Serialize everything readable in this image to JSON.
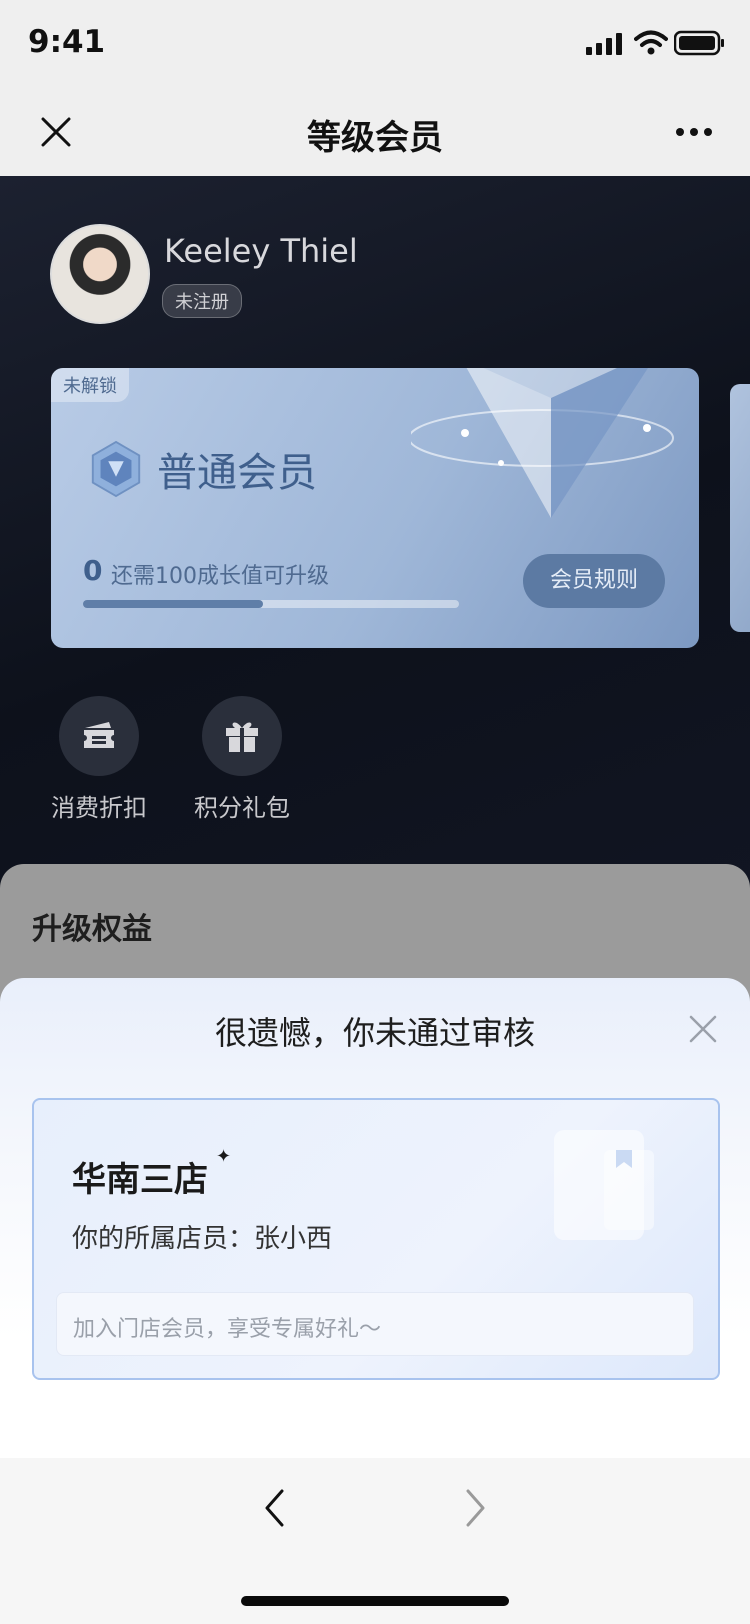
{
  "status": {
    "time": "9:41"
  },
  "nav": {
    "title": "等级会员"
  },
  "user": {
    "name": "Keeley Thiel",
    "badge": "未注册"
  },
  "member_card": {
    "lock_tag": "未解锁",
    "level_name": "普通会员",
    "progress_value": "0",
    "progress_hint": "还需100成长值可升级",
    "progress_fraction": 0.48,
    "rule_button": "会员规则"
  },
  "quick_entries": [
    {
      "label": "消费折扣",
      "icon": "ticket-icon"
    },
    {
      "label": "积分礼包",
      "icon": "gift-icon"
    }
  ],
  "section": {
    "title": "升级权益"
  },
  "sheet": {
    "title": "很遗憾，你未通过审核",
    "store": {
      "name": "华南三店",
      "staff": "你的所属店员：张小西",
      "hint": "加入门店会员，享受专属好礼～"
    }
  },
  "bottom_nav": {
    "back_icon": "chevron-left-icon",
    "forward_icon": "chevron-right-icon"
  }
}
